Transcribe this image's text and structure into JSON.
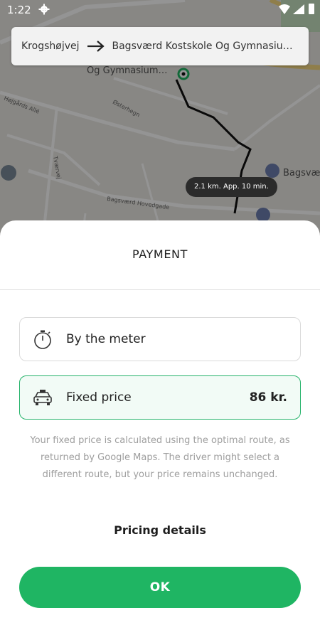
{
  "status_bar": {
    "time": "1:22"
  },
  "map": {
    "route_from": "Krogshøjvej",
    "route_to": "Bagsværd Kostskole Og Gymnasium…",
    "eta": "2.1 km. App. 10 min.",
    "labels": [
      "Og Gymnasium…",
      "Bagsværd Hovedgade",
      "Højgårds Allé",
      "Bagsværd",
      "Tværvej",
      "Østerhegn"
    ]
  },
  "payment": {
    "title": "PAYMENT",
    "options": [
      {
        "label": "By the meter",
        "icon": "stopwatch-icon"
      },
      {
        "label": "Fixed price",
        "icon": "taxi-icon",
        "price": "86 kr."
      }
    ],
    "description": "Your fixed price is calculated using the optimal route, as returned by Google Maps. The driver might select a different route, but your price remains unchanged.",
    "pricing_details": "Pricing details",
    "ok_label": "OK"
  },
  "colors": {
    "accent": "#1fb563",
    "selected_bg": "#f2fbf6"
  }
}
